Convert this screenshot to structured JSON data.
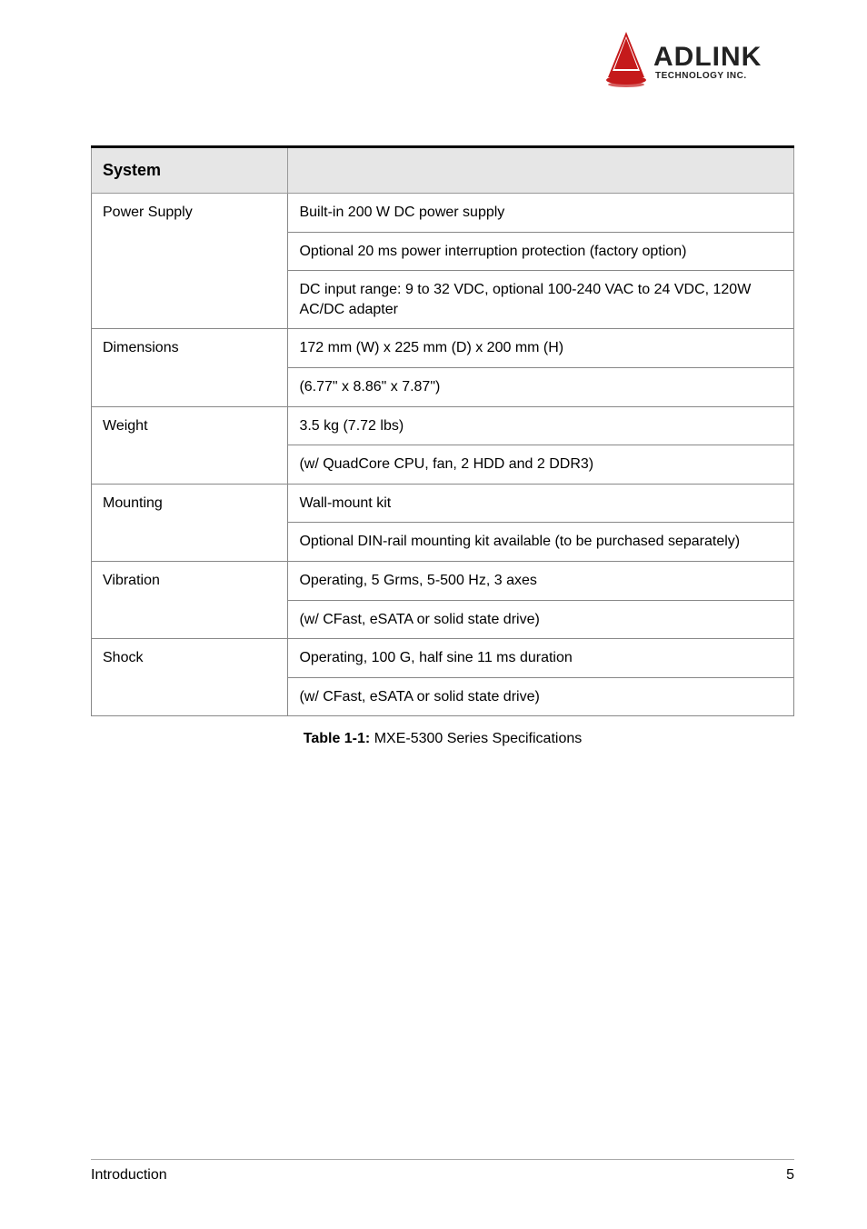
{
  "logo": {
    "topText": "ADLINK",
    "subText": "TECHNOLOGY INC."
  },
  "table": {
    "headers": [
      "System",
      ""
    ],
    "groups": [
      {
        "label": "Power Supply",
        "rows": [
          "Built-in 200 W DC power supply",
          "Optional 20 ms power interruption protection (factory option)",
          "DC input range: 9 to 32 VDC, optional 100-240 VAC to 24 VDC, 120W AC/DC adapter"
        ]
      },
      {
        "label": "Dimensions",
        "rows": [
          "172 mm (W) x 225 mm (D) x 200 mm (H)",
          "(6.77\" x 8.86\" x 7.87\")"
        ]
      },
      {
        "label": "Weight",
        "rows": [
          "3.5 kg (7.72 lbs)",
          "(w/ QuadCore CPU, fan, 2 HDD and 2 DDR3)"
        ]
      },
      {
        "label": "Mounting",
        "rows": [
          "Wall-mount kit",
          "Optional DIN-rail mounting kit available (to be purchased separately)"
        ]
      },
      {
        "label": "Vibration",
        "rows": [
          "Operating, 5 Grms, 5-500 Hz, 3 axes",
          "(w/ CFast, eSATA or solid state drive)"
        ]
      },
      {
        "label": "Shock",
        "rows": [
          "Operating, 100 G, half sine 11 ms duration",
          "(w/ CFast, eSATA or solid state drive)"
        ]
      }
    ]
  },
  "caption": {
    "prefix": "Table 1-1:",
    "text": "MXE-5300 Series Specifications"
  },
  "footer": {
    "left": "Introduction",
    "right": "5"
  }
}
